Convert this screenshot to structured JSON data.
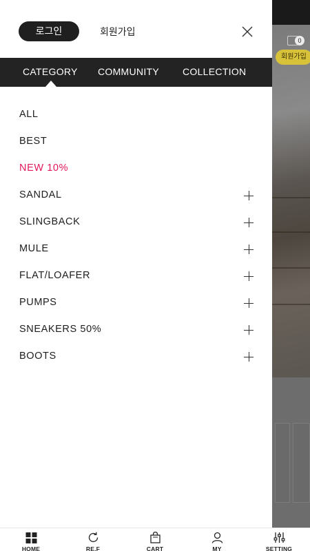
{
  "header": {
    "login_label": "로그인",
    "signup_label": "회원가입",
    "close_icon": "close-icon"
  },
  "tabs": [
    {
      "label": "CATEGORY",
      "active": true
    },
    {
      "label": "COMMUNITY",
      "active": false
    },
    {
      "label": "COLLECTION",
      "active": false
    }
  ],
  "categories": [
    {
      "label": "ALL",
      "expandable": false
    },
    {
      "label": "BEST",
      "expandable": false
    },
    {
      "label": "NEW 10%",
      "expandable": false,
      "highlight_color": "#e3165b"
    },
    {
      "label": "SANDAL",
      "expandable": true
    },
    {
      "label": "SLINGBACK",
      "expandable": true
    },
    {
      "label": "MULE",
      "expandable": true
    },
    {
      "label": "FLAT/LOAFER",
      "expandable": true
    },
    {
      "label": "PUMPS",
      "expandable": true
    },
    {
      "label": "SNEAKERS 50%",
      "expandable": true
    },
    {
      "label": "BOOTS",
      "expandable": true
    }
  ],
  "background": {
    "join_badge": "회원가입",
    "cart_count": "0"
  },
  "bottom_nav": [
    {
      "label": "HOME",
      "icon": "home-icon"
    },
    {
      "label": "RE.F",
      "icon": "refresh-icon"
    },
    {
      "label": "CART",
      "icon": "cart-icon"
    },
    {
      "label": "MY",
      "icon": "user-icon"
    },
    {
      "label": "SETTING",
      "icon": "settings-icon"
    }
  ],
  "colors": {
    "tab_bar": "#232323",
    "login_button": "#1f1f1f",
    "highlight": "#e3165b",
    "overlay": "#6d6d6d"
  }
}
